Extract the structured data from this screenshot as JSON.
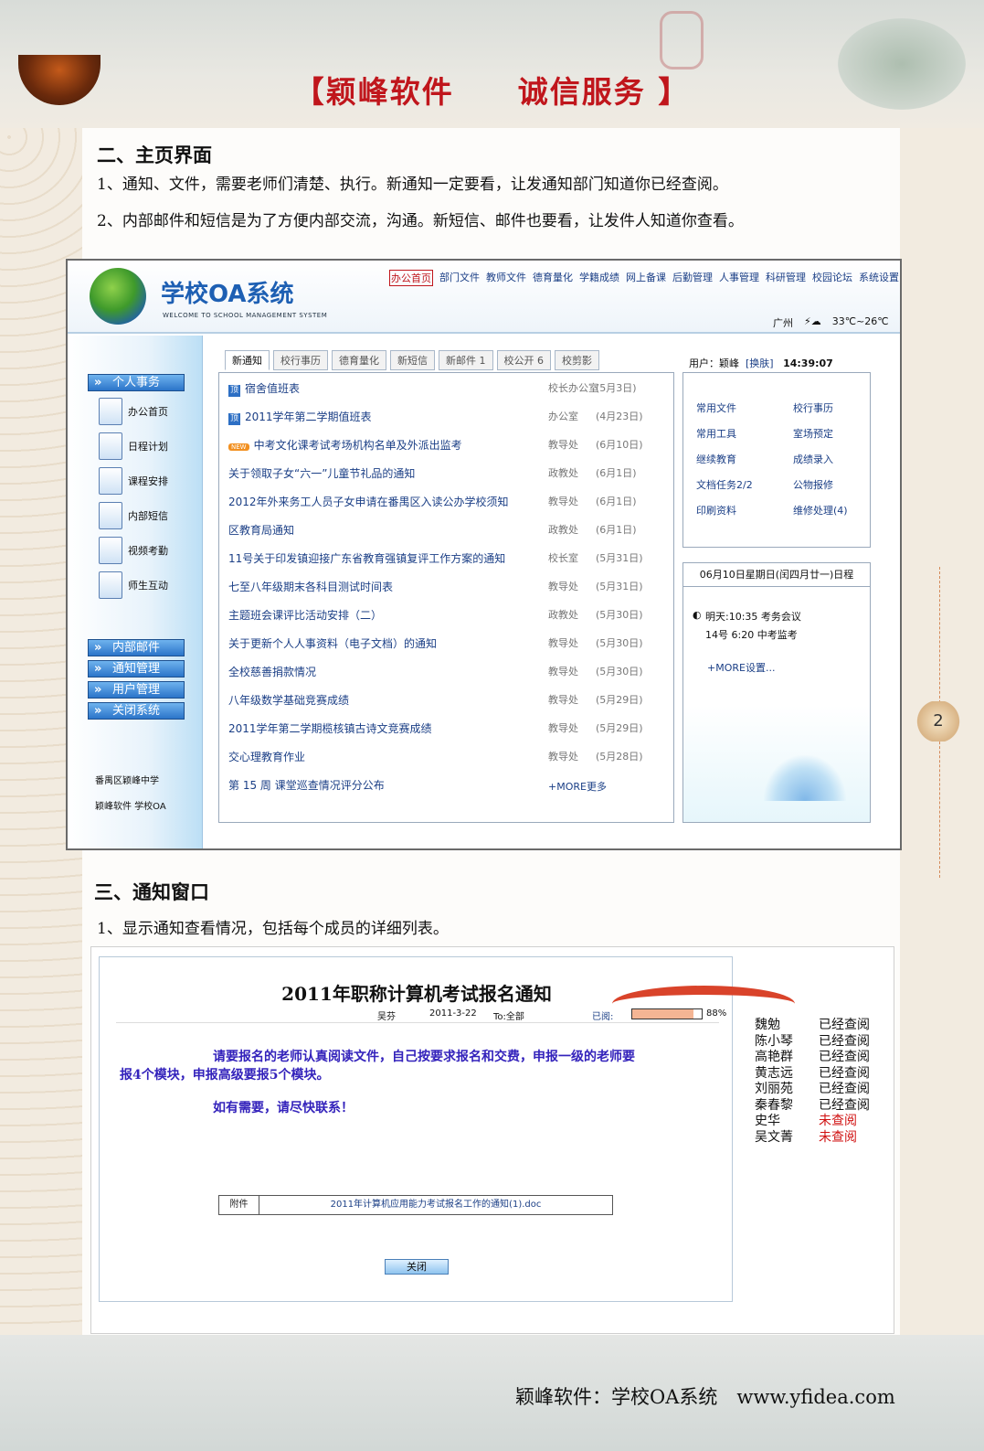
{
  "header": {
    "title": "【颖峰软件　　诚信服务 】"
  },
  "section2": {
    "heading": "二、主页界面",
    "p1": "1、通知、文件，需要老师们清楚、执行。新通知一定要看，让发通知部门知道你已经查阅。",
    "p2": "2、内部邮件和短信是为了方便内部交流，沟通。新短信、邮件也要看，让发件人知道你查看。"
  },
  "oa": {
    "logo_text": "学校OA系统",
    "logo_sub": "WELCOME TO SCHOOL MANAGEMENT SYSTEM",
    "nav": [
      "办公首页",
      "部门文件",
      "教师文件",
      "德育量化",
      "学籍成绩",
      "网上备课",
      "后勤管理",
      "人事管理",
      "科研管理",
      "校园论坛",
      "系统设置"
    ],
    "weather": {
      "city": "广州",
      "temp": "33℃~26℃"
    },
    "side_buttons": [
      "个人事务",
      "内部邮件",
      "通知管理",
      "用户管理",
      "关闭系统"
    ],
    "side_items": [
      "办公首页",
      "日程计划",
      "课程安排",
      "内部短信",
      "视频考勤",
      "师生互动"
    ],
    "side_footer": [
      "番禺区颖峰中学",
      "颖峰软件 学校OA"
    ],
    "tabs": [
      "新通知",
      "校行事历",
      "德育量化",
      "新短信",
      "新邮件 1",
      "校公开 6",
      "校剪影"
    ],
    "user": {
      "label": "用户：",
      "name": "颖峰",
      "switch": "[换肤]",
      "time": "14:39:07"
    },
    "notices": [
      {
        "title": "宿舍值班表",
        "dept": "校长办公室",
        "date": "(5月3日)",
        "badge": "顶"
      },
      {
        "title": "2011学年第二学期值班表",
        "dept": "办公室",
        "date": "(4月23日)",
        "badge": "顶"
      },
      {
        "title": "中考文化课考试考场机构名单及外派出监考",
        "dept": "教导处",
        "date": "(6月10日)",
        "badge": "NEW"
      },
      {
        "title": "关于领取子女“六一”儿童节礼品的通知",
        "dept": "政教处",
        "date": "(6月1日)",
        "badge": ""
      },
      {
        "title": "2012年外来务工人员子女申请在番禺区入读公办学校须知",
        "dept": "教导处",
        "date": "(6月1日)",
        "badge": ""
      },
      {
        "title": "区教育局通知",
        "dept": "政教处",
        "date": "(6月1日)",
        "badge": ""
      },
      {
        "title": "11号关于印发镇迎接广东省教育强镇复评工作方案的通知",
        "dept": "校长室",
        "date": "(5月31日)",
        "badge": ""
      },
      {
        "title": "七至八年级期末各科目测试时间表",
        "dept": "教导处",
        "date": "(5月31日)",
        "badge": ""
      },
      {
        "title": "主题班会课评比活动安排（二）",
        "dept": "政教处",
        "date": "(5月30日)",
        "badge": ""
      },
      {
        "title": "关于更新个人人事资料（电子文档）的通知",
        "dept": "教导处",
        "date": "(5月30日)",
        "badge": ""
      },
      {
        "title": "全校慈善捐款情况",
        "dept": "教导处",
        "date": "(5月30日)",
        "badge": ""
      },
      {
        "title": "八年级数学基础竞赛成绩",
        "dept": "教导处",
        "date": "(5月29日)",
        "badge": ""
      },
      {
        "title": "2011学年第二学期榄核镇古诗文竞赛成绩",
        "dept": "教导处",
        "date": "(5月29日)",
        "badge": ""
      },
      {
        "title": "交心理教育作业",
        "dept": "教导处",
        "date": "(5月28日)",
        "badge": ""
      },
      {
        "title": "第 15 周 课堂巡查情况评分公布",
        "dept": "",
        "date": "",
        "badge": ""
      }
    ],
    "more": "+MORE更多",
    "quick": [
      "常用文件",
      "校行事历",
      "常用工具",
      "室场预定",
      "继续教育",
      "成绩录入",
      "文档任务2/2",
      "公物报修",
      "印刷资料",
      "维修处理(4)"
    ],
    "schedule": {
      "head": "06月10日星期日(闰四月廿一)日程",
      "l1": "明天:10:35 考务会议",
      "l2": "14号 6:20 中考监考",
      "setting": "+MORE设置..."
    }
  },
  "section3": {
    "heading": "三、通知窗口",
    "p1": "1、显示通知查看情况，包括每个成员的详细列表。"
  },
  "notice": {
    "title": "2011年职称计算机考试报名通知",
    "author": "吴芬",
    "date": "2011-3-22",
    "to": "To:全部",
    "read_label": "已阅:",
    "read_pct": "88%",
    "read_fraction": 0.88,
    "body1": "请要报名的老师认真阅读文件，自己按要求报名和交费，申报一级的老师要",
    "body2": "报4个模块，申报高级要报5个模块。",
    "body3": "如有需要，请尽快联系！",
    "attach_label": "附件",
    "attach_file": "2011年计算机应用能力考试报名工作的通知(1).doc",
    "close": "关闭"
  },
  "status": [
    {
      "name": "魏勉",
      "state": "已经查阅",
      "read": true
    },
    {
      "name": "陈小琴",
      "state": "已经查阅",
      "read": true
    },
    {
      "name": "高艳群",
      "state": "已经查阅",
      "read": true
    },
    {
      "name": "黄志远",
      "state": "已经查阅",
      "read": true
    },
    {
      "name": "刘丽苑",
      "state": "已经查阅",
      "read": true
    },
    {
      "name": "秦春黎",
      "state": "已经查阅",
      "read": true
    },
    {
      "name": "史华",
      "state": "未查阅",
      "read": false
    },
    {
      "name": "吴文菁",
      "state": "未查阅",
      "read": false
    }
  ],
  "page_number": "2",
  "footer": "颖峰软件：学校OA系统　www.yfidea.com"
}
